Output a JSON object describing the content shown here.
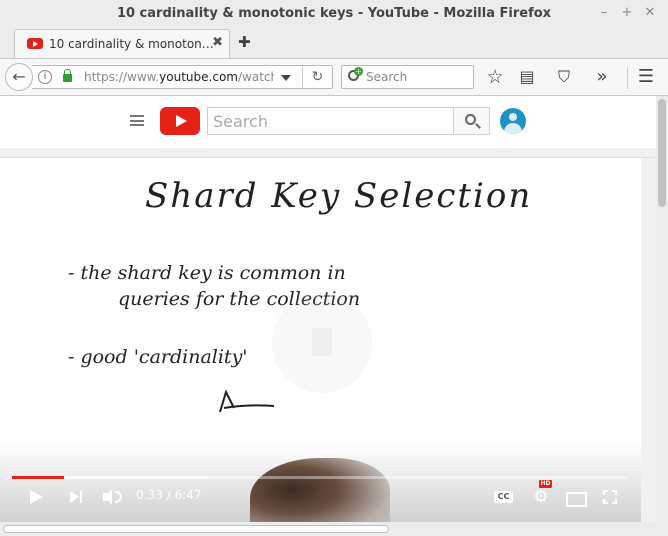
{
  "window": {
    "title": "10 cardinality & monotonic keys - YouTube - Mozilla Firefox",
    "controls": [
      "–",
      "+",
      "✕"
    ]
  },
  "tabs": [
    {
      "label": "10 cardinality & monoton…",
      "close": "✖"
    }
  ],
  "new_tab_label": "✚",
  "navbar": {
    "back_glyph": "←",
    "url_prefix": "https://www.",
    "url_host": "youtube.com",
    "url_rest": "/watch?v",
    "reload_glyph": "↻",
    "search_placeholder": "Search",
    "icons": {
      "bookmark": "☆",
      "reading_list": "▤",
      "pocket": "⛉",
      "overflow": "»",
      "menu": "☰"
    }
  },
  "youtube": {
    "search_placeholder": "Search"
  },
  "video": {
    "whiteboard": {
      "title": "Shard Key Selection",
      "bullet1_line1": "- the shard key is common in",
      "bullet1_line2": "queries for the collection",
      "bullet2": "- good 'cardinality'"
    },
    "progress": {
      "played_fraction": 0.084,
      "buffered_fraction": 0.32
    },
    "current_time": "0:33",
    "duration": "6:47",
    "time_separator": " / ",
    "quality_badge": "HD"
  }
}
